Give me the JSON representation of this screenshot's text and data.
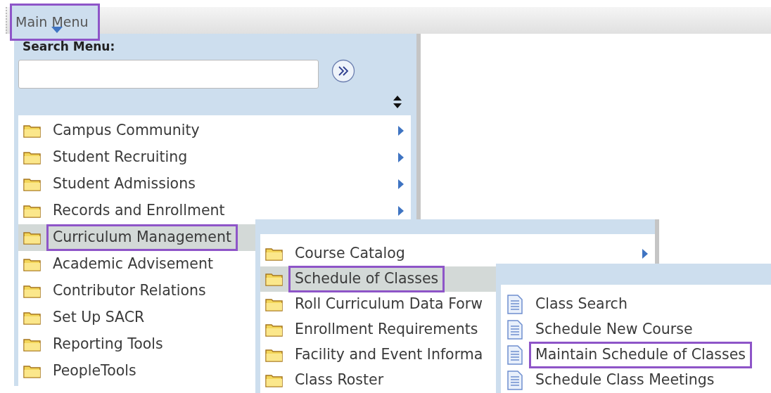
{
  "top_bar": {
    "main_menu": {
      "label": "Main Menu",
      "highlighted": true
    }
  },
  "menu": {
    "search_label": "Search Menu:",
    "items": [
      {
        "label": "Campus Community",
        "kind": "folder",
        "has_submenu": true,
        "selected": false,
        "highlighted": false
      },
      {
        "label": "Student Recruiting",
        "kind": "folder",
        "has_submenu": true,
        "selected": false,
        "highlighted": false
      },
      {
        "label": "Student Admissions",
        "kind": "folder",
        "has_submenu": true,
        "selected": false,
        "highlighted": false
      },
      {
        "label": "Records and Enrollment",
        "kind": "folder",
        "has_submenu": true,
        "selected": false,
        "highlighted": false
      },
      {
        "label": "Curriculum Management",
        "kind": "folder",
        "has_submenu": false,
        "selected": true,
        "highlighted": true
      },
      {
        "label": "Academic Advisement",
        "kind": "folder",
        "has_submenu": false,
        "selected": false,
        "highlighted": false
      },
      {
        "label": "Contributor Relations",
        "kind": "folder",
        "has_submenu": false,
        "selected": false,
        "highlighted": false
      },
      {
        "label": "Set Up SACR",
        "kind": "folder",
        "has_submenu": false,
        "selected": false,
        "highlighted": false
      },
      {
        "label": "Reporting Tools",
        "kind": "folder",
        "has_submenu": false,
        "selected": false,
        "highlighted": false
      },
      {
        "label": "PeopleTools",
        "kind": "folder",
        "has_submenu": false,
        "selected": false,
        "highlighted": false
      }
    ]
  },
  "flyouts": [
    {
      "items": [
        {
          "label": "Course Catalog",
          "kind": "folder",
          "has_submenu": true,
          "selected": false,
          "highlighted": false
        },
        {
          "label": "Schedule of Classes",
          "kind": "folder",
          "has_submenu": false,
          "selected": true,
          "highlighted": true
        },
        {
          "label": "Roll Curriculum Data Forw",
          "kind": "folder",
          "has_submenu": false,
          "selected": false,
          "highlighted": false
        },
        {
          "label": "Enrollment Requirements",
          "kind": "folder",
          "has_submenu": false,
          "selected": false,
          "highlighted": false
        },
        {
          "label": "Facility and Event Informa",
          "kind": "folder",
          "has_submenu": false,
          "selected": false,
          "highlighted": false
        },
        {
          "label": "Class Roster",
          "kind": "folder",
          "has_submenu": false,
          "selected": false,
          "highlighted": false
        }
      ]
    },
    {
      "items": [
        {
          "label": "Class Search",
          "kind": "page",
          "has_submenu": false,
          "selected": false,
          "highlighted": false
        },
        {
          "label": "Schedule New Course",
          "kind": "page",
          "has_submenu": false,
          "selected": false,
          "highlighted": false
        },
        {
          "label": "Maintain Schedule of Classes",
          "kind": "page",
          "has_submenu": false,
          "selected": false,
          "highlighted": true
        },
        {
          "label": "Schedule Class Meetings",
          "kind": "page",
          "has_submenu": false,
          "selected": false,
          "highlighted": false
        }
      ]
    }
  ]
}
